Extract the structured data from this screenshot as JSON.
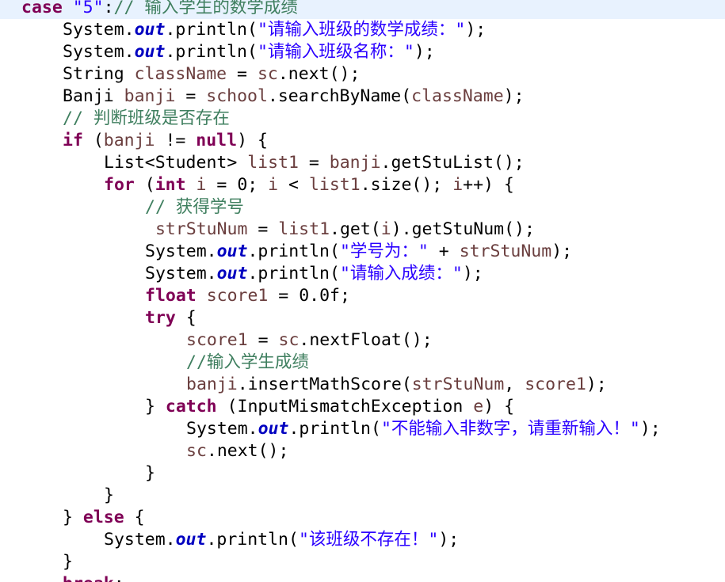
{
  "editor": {
    "colors": {
      "keyword": "#7f0055",
      "field": "#0000c0",
      "variable": "#6a3e3e",
      "string": "#2a00ff",
      "comment": "#3f7f5f",
      "plain": "#000000",
      "current_line": "#e8f2fe",
      "background": "#ffffff"
    },
    "lines": [
      {
        "indent": 0,
        "current": true,
        "tokens": [
          {
            "t": "case ",
            "k": "kw"
          },
          {
            "t": "\"5\"",
            "k": "str"
          },
          {
            "t": ":",
            "k": "pl"
          },
          {
            "t": "// 输入学生的数学成绩",
            "k": "cm"
          }
        ]
      },
      {
        "indent": 2,
        "tokens": [
          {
            "t": "System.",
            "k": "pl"
          },
          {
            "t": "out",
            "k": "fld"
          },
          {
            "t": ".println(",
            "k": "pl"
          },
          {
            "t": "\"请输入班级的数学成绩：\"",
            "k": "str"
          },
          {
            "t": ");",
            "k": "pl"
          }
        ]
      },
      {
        "indent": 2,
        "tokens": [
          {
            "t": "System.",
            "k": "pl"
          },
          {
            "t": "out",
            "k": "fld"
          },
          {
            "t": ".println(",
            "k": "pl"
          },
          {
            "t": "\"请输入班级名称：\"",
            "k": "str"
          },
          {
            "t": ");",
            "k": "pl"
          }
        ]
      },
      {
        "indent": 2,
        "tokens": [
          {
            "t": "String ",
            "k": "pl"
          },
          {
            "t": "className",
            "k": "var"
          },
          {
            "t": " = ",
            "k": "pl"
          },
          {
            "t": "sc",
            "k": "var"
          },
          {
            "t": ".next();",
            "k": "pl"
          }
        ]
      },
      {
        "indent": 2,
        "tokens": [
          {
            "t": "Banji ",
            "k": "pl"
          },
          {
            "t": "banji",
            "k": "var"
          },
          {
            "t": " = ",
            "k": "pl"
          },
          {
            "t": "school",
            "k": "var"
          },
          {
            "t": ".searchByName(",
            "k": "pl"
          },
          {
            "t": "className",
            "k": "var"
          },
          {
            "t": ");",
            "k": "pl"
          }
        ]
      },
      {
        "indent": 2,
        "tokens": [
          {
            "t": "// 判断班级是否存在",
            "k": "cm"
          }
        ]
      },
      {
        "indent": 2,
        "tokens": [
          {
            "t": "if",
            "k": "kw"
          },
          {
            "t": " (",
            "k": "pl"
          },
          {
            "t": "banji",
            "k": "var"
          },
          {
            "t": " != ",
            "k": "pl"
          },
          {
            "t": "null",
            "k": "kw"
          },
          {
            "t": ") {",
            "k": "pl"
          }
        ]
      },
      {
        "indent": 3,
        "tokens": [
          {
            "t": "List<Student> ",
            "k": "pl"
          },
          {
            "t": "list1",
            "k": "var"
          },
          {
            "t": " = ",
            "k": "pl"
          },
          {
            "t": "banji",
            "k": "var"
          },
          {
            "t": ".getStuList();",
            "k": "pl"
          }
        ]
      },
      {
        "indent": 3,
        "tokens": [
          {
            "t": "for",
            "k": "kw"
          },
          {
            "t": " (",
            "k": "pl"
          },
          {
            "t": "int",
            "k": "kw"
          },
          {
            "t": " ",
            "k": "pl"
          },
          {
            "t": "i",
            "k": "var"
          },
          {
            "t": " = 0; ",
            "k": "pl"
          },
          {
            "t": "i",
            "k": "var"
          },
          {
            "t": " < ",
            "k": "pl"
          },
          {
            "t": "list1",
            "k": "var"
          },
          {
            "t": ".size(); ",
            "k": "pl"
          },
          {
            "t": "i",
            "k": "var"
          },
          {
            "t": "++) {",
            "k": "pl"
          }
        ]
      },
      {
        "indent": 4,
        "tokens": [
          {
            "t": "// 获得学号",
            "k": "cm"
          }
        ]
      },
      {
        "indent": 4,
        "tokens": [
          {
            "t": " ",
            "k": "pl"
          },
          {
            "t": "strStuNum",
            "k": "var"
          },
          {
            "t": " = ",
            "k": "pl"
          },
          {
            "t": "list1",
            "k": "var"
          },
          {
            "t": ".get(",
            "k": "pl"
          },
          {
            "t": "i",
            "k": "var"
          },
          {
            "t": ").getStuNum();",
            "k": "pl"
          }
        ]
      },
      {
        "indent": 4,
        "tokens": [
          {
            "t": "System.",
            "k": "pl"
          },
          {
            "t": "out",
            "k": "fld"
          },
          {
            "t": ".println(",
            "k": "pl"
          },
          {
            "t": "\"学号为：\"",
            "k": "str"
          },
          {
            "t": " + ",
            "k": "pl"
          },
          {
            "t": "strStuNum",
            "k": "var"
          },
          {
            "t": ");",
            "k": "pl"
          }
        ]
      },
      {
        "indent": 4,
        "tokens": [
          {
            "t": "System.",
            "k": "pl"
          },
          {
            "t": "out",
            "k": "fld"
          },
          {
            "t": ".println(",
            "k": "pl"
          },
          {
            "t": "\"请输入成绩：\"",
            "k": "str"
          },
          {
            "t": ");",
            "k": "pl"
          }
        ]
      },
      {
        "indent": 4,
        "tokens": [
          {
            "t": "float",
            "k": "kw"
          },
          {
            "t": " ",
            "k": "pl"
          },
          {
            "t": "score1",
            "k": "var"
          },
          {
            "t": " = 0.0f;",
            "k": "pl"
          }
        ]
      },
      {
        "indent": 4,
        "tokens": [
          {
            "t": "try",
            "k": "kw"
          },
          {
            "t": " {",
            "k": "pl"
          }
        ]
      },
      {
        "indent": 5,
        "tokens": [
          {
            "t": "score1",
            "k": "var"
          },
          {
            "t": " = ",
            "k": "pl"
          },
          {
            "t": "sc",
            "k": "var"
          },
          {
            "t": ".nextFloat();",
            "k": "pl"
          }
        ]
      },
      {
        "indent": 5,
        "tokens": [
          {
            "t": "//输入学生成绩",
            "k": "cm"
          }
        ]
      },
      {
        "indent": 5,
        "tokens": [
          {
            "t": "banji",
            "k": "var"
          },
          {
            "t": ".insertMathScore(",
            "k": "pl"
          },
          {
            "t": "strStuNum",
            "k": "var"
          },
          {
            "t": ", ",
            "k": "pl"
          },
          {
            "t": "score1",
            "k": "var"
          },
          {
            "t": ");",
            "k": "pl"
          }
        ]
      },
      {
        "indent": 4,
        "tokens": [
          {
            "t": "} ",
            "k": "pl"
          },
          {
            "t": "catch",
            "k": "kw"
          },
          {
            "t": " (InputMismatchException ",
            "k": "pl"
          },
          {
            "t": "e",
            "k": "var"
          },
          {
            "t": ") {",
            "k": "pl"
          }
        ]
      },
      {
        "indent": 5,
        "tokens": [
          {
            "t": "System.",
            "k": "pl"
          },
          {
            "t": "out",
            "k": "fld"
          },
          {
            "t": ".println(",
            "k": "pl"
          },
          {
            "t": "\"不能输入非数字，请重新输入！\"",
            "k": "str"
          },
          {
            "t": ");",
            "k": "pl"
          }
        ]
      },
      {
        "indent": 5,
        "tokens": [
          {
            "t": "sc",
            "k": "var"
          },
          {
            "t": ".next();",
            "k": "pl"
          }
        ]
      },
      {
        "indent": 4,
        "tokens": [
          {
            "t": "}",
            "k": "pl"
          }
        ]
      },
      {
        "indent": 3,
        "tokens": [
          {
            "t": "}",
            "k": "pl"
          }
        ]
      },
      {
        "indent": 2,
        "tokens": [
          {
            "t": "} ",
            "k": "pl"
          },
          {
            "t": "else",
            "k": "kw"
          },
          {
            "t": " {",
            "k": "pl"
          }
        ]
      },
      {
        "indent": 3,
        "tokens": [
          {
            "t": "System.",
            "k": "pl"
          },
          {
            "t": "out",
            "k": "fld"
          },
          {
            "t": ".println(",
            "k": "pl"
          },
          {
            "t": "\"该班级不存在！\"",
            "k": "str"
          },
          {
            "t": ");",
            "k": "pl"
          }
        ]
      },
      {
        "indent": 2,
        "tokens": [
          {
            "t": "}",
            "k": "pl"
          }
        ]
      },
      {
        "indent": 2,
        "tokens": [
          {
            "t": "break",
            "k": "kw"
          },
          {
            "t": ";",
            "k": "pl"
          }
        ]
      }
    ]
  }
}
